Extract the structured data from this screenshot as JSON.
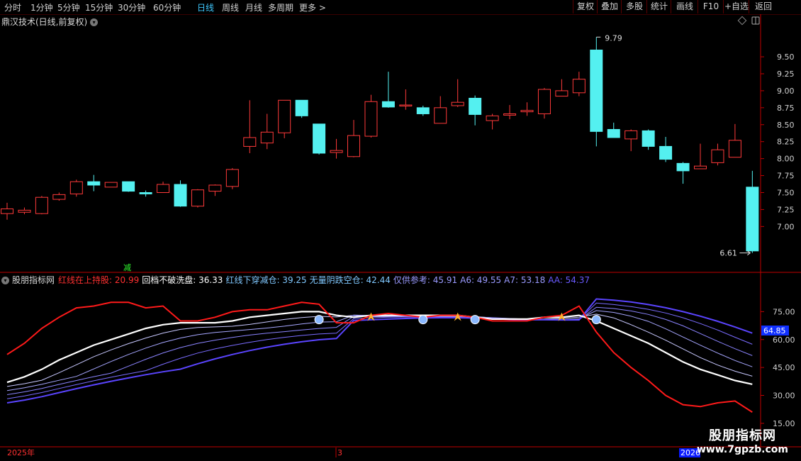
{
  "toolbar": {
    "periods": [
      "分时",
      "1分钟",
      "5分钟",
      "15分钟",
      "30分钟",
      "60分钟",
      "日线",
      "周线",
      "月线",
      "多周期",
      "更多 >"
    ],
    "active_period": "日线",
    "buttons": [
      "复权",
      "叠加",
      "多股",
      "统计",
      "画线",
      "F10",
      "+自选",
      "返回"
    ]
  },
  "main_panel": {
    "title": "鼎汉技术(日线,前复权)",
    "price_axis": [
      "9.50",
      "9.25",
      "9.00",
      "8.75",
      "8.50",
      "8.25",
      "8.00",
      "7.75",
      "7.50",
      "7.25",
      "7.00"
    ],
    "high_label": "9.79",
    "low_label": "6.61",
    "marker": "减",
    "colors": {
      "up": "#ff3a3a",
      "down": "#54f0f0"
    }
  },
  "indicator_panel": {
    "name": "股朋指标网",
    "legend": [
      {
        "label": "红线在上持股:",
        "value": "20.99",
        "color": "#ff3030"
      },
      {
        "label": "回档不破洗盘:",
        "value": "36.33",
        "color": "#ffffff"
      },
      {
        "label": "红线下穿减仓:",
        "value": "39.25",
        "color": "#80c8ff"
      },
      {
        "label": "无量阴跌空仓:",
        "value": "42.44",
        "color": "#80c8ff"
      },
      {
        "label": "仅供参考:",
        "value": "45.91",
        "color": "#9a9aff"
      },
      {
        "label": "A6:",
        "value": "49.55",
        "color": "#9a9aff"
      },
      {
        "label": "A7:",
        "value": "53.18",
        "color": "#9a9aff"
      },
      {
        "label": "AA:",
        "value": "54.37",
        "color": "#6a5aff"
      }
    ],
    "axis": [
      "75.00",
      "60.00",
      "45.00",
      "30.00",
      "15.00"
    ],
    "current_value": "64.85"
  },
  "time_axis": {
    "left": "2025年",
    "mid": "3",
    "right": "2026"
  },
  "watermark": {
    "line1": "股朋指标网",
    "line2": "www.7gpzb.com"
  },
  "chart_data": {
    "type": "candlestick",
    "price_range": [
      6.45,
      9.95
    ],
    "candles": [
      {
        "o": 7.19,
        "h": 7.35,
        "l": 7.1,
        "c": 7.26
      },
      {
        "o": 7.21,
        "h": 7.28,
        "l": 7.18,
        "c": 7.24
      },
      {
        "o": 7.19,
        "h": 7.45,
        "l": 7.18,
        "c": 7.43
      },
      {
        "o": 7.4,
        "h": 7.5,
        "l": 7.38,
        "c": 7.47
      },
      {
        "o": 7.48,
        "h": 7.69,
        "l": 7.44,
        "c": 7.66
      },
      {
        "o": 7.66,
        "h": 7.76,
        "l": 7.52,
        "c": 7.61
      },
      {
        "o": 7.58,
        "h": 7.65,
        "l": 7.58,
        "c": 7.65
      },
      {
        "o": 7.66,
        "h": 7.66,
        "l": 7.51,
        "c": 7.52
      },
      {
        "o": 7.5,
        "h": 7.53,
        "l": 7.44,
        "c": 7.48
      },
      {
        "o": 7.5,
        "h": 7.66,
        "l": 7.5,
        "c": 7.62
      },
      {
        "o": 7.62,
        "h": 7.68,
        "l": 7.29,
        "c": 7.3
      },
      {
        "o": 7.3,
        "h": 7.55,
        "l": 7.28,
        "c": 7.54
      },
      {
        "o": 7.52,
        "h": 7.62,
        "l": 7.45,
        "c": 7.61
      },
      {
        "o": 7.59,
        "h": 7.86,
        "l": 7.55,
        "c": 7.84
      },
      {
        "o": 8.18,
        "h": 8.86,
        "l": 8.08,
        "c": 8.31
      },
      {
        "o": 8.23,
        "h": 8.66,
        "l": 8.14,
        "c": 8.39
      },
      {
        "o": 8.38,
        "h": 8.85,
        "l": 8.3,
        "c": 8.86
      },
      {
        "o": 8.86,
        "h": 8.86,
        "l": 8.6,
        "c": 8.63
      },
      {
        "o": 8.51,
        "h": 8.51,
        "l": 8.06,
        "c": 8.08
      },
      {
        "o": 8.09,
        "h": 8.29,
        "l": 8.0,
        "c": 8.12
      },
      {
        "o": 8.03,
        "h": 8.57,
        "l": 8.02,
        "c": 8.34
      },
      {
        "o": 8.33,
        "h": 8.94,
        "l": 8.31,
        "c": 8.84
      },
      {
        "o": 8.84,
        "h": 9.28,
        "l": 8.75,
        "c": 8.76
      },
      {
        "o": 8.78,
        "h": 9.02,
        "l": 8.72,
        "c": 8.79
      },
      {
        "o": 8.75,
        "h": 8.78,
        "l": 8.63,
        "c": 8.66
      },
      {
        "o": 8.52,
        "h": 8.92,
        "l": 8.52,
        "c": 8.75
      },
      {
        "o": 8.78,
        "h": 9.17,
        "l": 8.76,
        "c": 8.83
      },
      {
        "o": 8.89,
        "h": 8.93,
        "l": 8.49,
        "c": 8.65
      },
      {
        "o": 8.56,
        "h": 8.66,
        "l": 8.43,
        "c": 8.63
      },
      {
        "o": 8.64,
        "h": 8.79,
        "l": 8.58,
        "c": 8.66
      },
      {
        "o": 8.69,
        "h": 8.83,
        "l": 8.63,
        "c": 8.71
      },
      {
        "o": 8.66,
        "h": 9.04,
        "l": 8.59,
        "c": 9.02
      },
      {
        "o": 8.92,
        "h": 9.17,
        "l": 8.92,
        "c": 9.0
      },
      {
        "o": 8.97,
        "h": 9.28,
        "l": 8.92,
        "c": 9.17
      },
      {
        "o": 9.6,
        "h": 9.79,
        "l": 8.18,
        "c": 8.4
      },
      {
        "o": 8.43,
        "h": 8.53,
        "l": 8.31,
        "c": 8.31
      },
      {
        "o": 8.29,
        "h": 8.43,
        "l": 8.11,
        "c": 8.41
      },
      {
        "o": 8.41,
        "h": 8.43,
        "l": 8.13,
        "c": 8.18
      },
      {
        "o": 8.18,
        "h": 8.32,
        "l": 7.95,
        "c": 7.99
      },
      {
        "o": 7.93,
        "h": 7.95,
        "l": 7.63,
        "c": 7.82
      },
      {
        "o": 7.85,
        "h": 8.22,
        "l": 7.85,
        "c": 7.89
      },
      {
        "o": 7.94,
        "h": 8.22,
        "l": 7.9,
        "c": 8.13
      },
      {
        "o": 8.02,
        "h": 8.51,
        "l": 8.02,
        "c": 8.27
      },
      {
        "o": 7.58,
        "h": 7.82,
        "l": 6.61,
        "c": 6.64
      }
    ],
    "indicator": {
      "y_range": [
        10,
        90
      ],
      "red": [
        [
          0,
          52
        ],
        [
          1,
          58
        ],
        [
          2,
          66
        ],
        [
          3,
          72
        ],
        [
          4,
          77
        ],
        [
          5,
          78
        ],
        [
          6,
          80
        ],
        [
          7,
          80
        ],
        [
          8,
          77
        ],
        [
          9,
          78
        ],
        [
          10,
          70
        ],
        [
          11,
          70
        ],
        [
          12,
          72
        ],
        [
          13,
          75
        ],
        [
          14,
          76
        ],
        [
          15,
          76
        ],
        [
          16,
          78
        ],
        [
          17,
          80
        ],
        [
          18,
          79
        ],
        [
          19,
          69
        ],
        [
          20,
          69
        ],
        [
          21,
          73
        ],
        [
          22,
          74
        ],
        [
          23,
          73
        ],
        [
          24,
          72
        ],
        [
          25,
          73
        ],
        [
          26,
          73
        ],
        [
          27,
          72
        ],
        [
          28,
          70
        ],
        [
          29,
          70
        ],
        [
          30,
          70
        ],
        [
          31,
          72
        ],
        [
          32,
          73
        ],
        [
          33,
          78
        ],
        [
          34,
          64
        ],
        [
          35,
          53
        ],
        [
          36,
          45
        ],
        [
          37,
          38
        ],
        [
          38,
          30
        ],
        [
          39,
          25
        ],
        [
          40,
          24
        ],
        [
          41,
          26
        ],
        [
          42,
          27
        ],
        [
          43,
          21
        ]
      ],
      "white": [
        [
          0,
          37
        ],
        [
          1,
          40
        ],
        [
          2,
          44
        ],
        [
          3,
          49
        ],
        [
          4,
          53
        ],
        [
          5,
          57
        ],
        [
          6,
          60
        ],
        [
          7,
          63
        ],
        [
          8,
          66
        ],
        [
          9,
          68
        ],
        [
          10,
          69
        ],
        [
          11,
          69
        ],
        [
          12,
          69
        ],
        [
          13,
          70
        ],
        [
          14,
          72
        ],
        [
          15,
          73
        ],
        [
          16,
          74
        ],
        [
          17,
          75
        ],
        [
          18,
          75
        ],
        [
          19,
          73
        ],
        [
          20,
          72
        ],
        [
          21,
          73
        ],
        [
          22,
          73
        ],
        [
          23,
          73
        ],
        [
          24,
          73
        ],
        [
          25,
          73
        ],
        [
          26,
          73
        ],
        [
          27,
          72
        ],
        [
          28,
          71
        ],
        [
          29,
          71
        ],
        [
          30,
          71
        ],
        [
          31,
          72
        ],
        [
          32,
          72
        ],
        [
          33,
          73
        ],
        [
          34,
          70
        ],
        [
          35,
          66
        ],
        [
          36,
          62
        ],
        [
          37,
          58
        ],
        [
          38,
          53
        ],
        [
          39,
          48
        ],
        [
          40,
          44
        ],
        [
          41,
          41
        ],
        [
          42,
          38
        ],
        [
          43,
          36
        ]
      ],
      "purple_levels": [
        1,
        2,
        3,
        4,
        5
      ]
    }
  }
}
